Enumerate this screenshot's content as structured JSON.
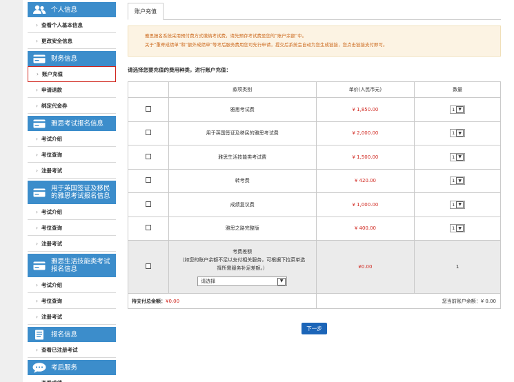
{
  "sidebar": {
    "sections": [
      {
        "title": "个人信息",
        "icon": "user-group-icon",
        "items": [
          "查看个人基本信息",
          "更改安全信息"
        ]
      },
      {
        "title": "财务信息",
        "icon": "card-icon",
        "items": [
          "账户充值",
          "申请退款",
          "绑定代金券"
        ]
      },
      {
        "title": "雅思考试报名信息",
        "icon": "card-icon",
        "items": [
          "考试介绍",
          "考位查询",
          "注册考试"
        ]
      },
      {
        "title": "用于英国签证及移民的雅思考试报名信息",
        "icon": "card-icon",
        "items": [
          "考试介绍",
          "考位查询",
          "注册考试"
        ]
      },
      {
        "title": "雅思生活技能类考试报名信息",
        "icon": "card-icon",
        "items": [
          "考试介绍",
          "考位查询",
          "注册考试"
        ]
      },
      {
        "title": "报名信息",
        "icon": "book-icon",
        "items": [
          "查看已注册考试"
        ]
      },
      {
        "title": "考后服务",
        "icon": "chat-icon",
        "items": [
          "查看成绩"
        ]
      }
    ],
    "active_item": "账户充值"
  },
  "main": {
    "tab_label": "账户充值",
    "notice_line1": "雅思报名系统采用预付费方式缴纳考试费，请先预存考试费至您的“账户余额”中。",
    "notice_line2": "关于“重寄成绩单”和“额外成绩单”等考后服务费用您可先行申请，提交后系统会自动为您生成链接，您点击链接支付即可。",
    "instruction": "请选择您要充值的费用种类，进行账户充值：",
    "table": {
      "headers": [
        "",
        "款项类别",
        "单价(人民币元)",
        "数量"
      ],
      "rows": [
        {
          "name": "雅思考试费",
          "price": "¥ 1,850.00",
          "qty": "1"
        },
        {
          "name": "用于英国签证及移民的雅思考试费",
          "price": "¥ 2,000.00",
          "qty": "1"
        },
        {
          "name": "雅思生活技能类考试费",
          "price": "¥ 1,500.00",
          "qty": "1"
        },
        {
          "name": "转考费",
          "price": "¥ 420.00",
          "qty": "1"
        },
        {
          "name": "成绩复议费",
          "price": "¥ 1,000.00",
          "qty": "1"
        },
        {
          "name": "雅思之路完整版",
          "price": "¥ 400.00",
          "qty": "1"
        }
      ],
      "diff_row": {
        "title": "考费差额",
        "desc1": "（如您的账户余额不足以支付相关服务，可根据下拉菜单选",
        "desc2": "择所需服务补足差额。）",
        "select_value": "请选择",
        "price": "¥0.00",
        "qty": "1"
      },
      "total_label": "待支付总金额：",
      "total_value": "¥0.00",
      "balance_label": "您当前账户余额：",
      "balance_value": "¥ 0.00"
    },
    "next_button": "下一步"
  }
}
